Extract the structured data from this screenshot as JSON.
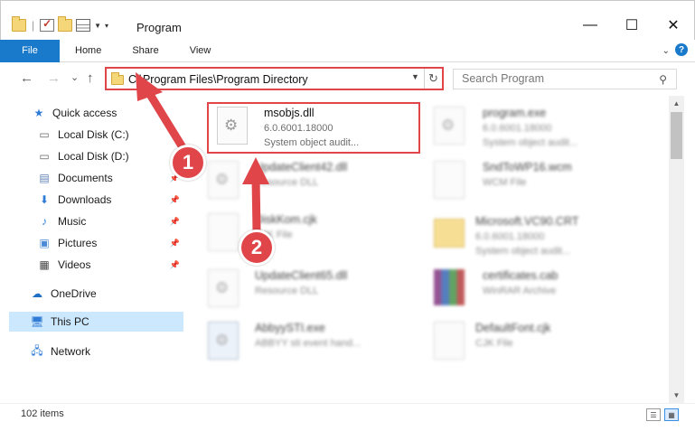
{
  "window": {
    "title": "Program",
    "minimize": "—",
    "maximize": "☐",
    "close": "✕"
  },
  "ribbon": {
    "tabs": [
      "File",
      "Home",
      "Share",
      "View"
    ],
    "help": "?"
  },
  "nav": {
    "back": "←",
    "forward": "→",
    "recent": "⌄",
    "up": "↑",
    "address": "C:\\Program Files\\Program Directory",
    "search_placeholder": "Search Program"
  },
  "sidebar": {
    "items": [
      {
        "label": "Quick access",
        "icon": "star-icon"
      },
      {
        "label": "Local Disk (C:)",
        "icon": "drive-icon"
      },
      {
        "label": "Local Disk (D:)",
        "icon": "drive-icon"
      },
      {
        "label": "Documents",
        "icon": "documents-icon",
        "pinned": true
      },
      {
        "label": "Downloads",
        "icon": "download-icon",
        "pinned": true
      },
      {
        "label": "Music",
        "icon": "music-icon",
        "pinned": true
      },
      {
        "label": "Pictures",
        "icon": "pictures-icon",
        "pinned": true
      },
      {
        "label": "Videos",
        "icon": "videos-icon",
        "pinned": true
      },
      {
        "label": "OneDrive",
        "icon": "cloud-icon"
      },
      {
        "label": "This PC",
        "icon": "computer-icon",
        "selected": true
      },
      {
        "label": "Network",
        "icon": "network-icon"
      }
    ]
  },
  "files": [
    {
      "name": "msobjs.dll",
      "line2": "6.0.6001.18000",
      "line3": "System object audit..."
    },
    {
      "name": "program.exe",
      "line2": "6.0.6001.18000",
      "line3": "System object audit..."
    },
    {
      "name": "UpdateClient42.dll",
      "line2": "Resource DLL",
      "line3": ""
    },
    {
      "name": "SndToWP16.wcm",
      "line2": "WCM File",
      "line3": ""
    },
    {
      "name": "DiskKom.cjk",
      "line2": "CJK File",
      "line3": ""
    },
    {
      "name": "Microsoft.VC90.CRT",
      "line2": "6.0.6001.18000",
      "line3": "System object audit..."
    },
    {
      "name": "UpdateClient65.dll",
      "line2": "Resource DLL",
      "line3": ""
    },
    {
      "name": "certificates.cab",
      "line2": "WinRAR Archive",
      "line3": ""
    },
    {
      "name": "AbbyySTI.exe",
      "line2": "ABBYY sti event hand...",
      "line3": ""
    },
    {
      "name": "DefaultFont.cjk",
      "line2": "CJK File",
      "line3": ""
    }
  ],
  "status": {
    "count": "102 items"
  },
  "annotations": {
    "marker1": "1",
    "marker2": "2",
    "color": "#e0454a"
  },
  "colors": {
    "accent": "#1979ca",
    "selection": "#cce8ff"
  }
}
